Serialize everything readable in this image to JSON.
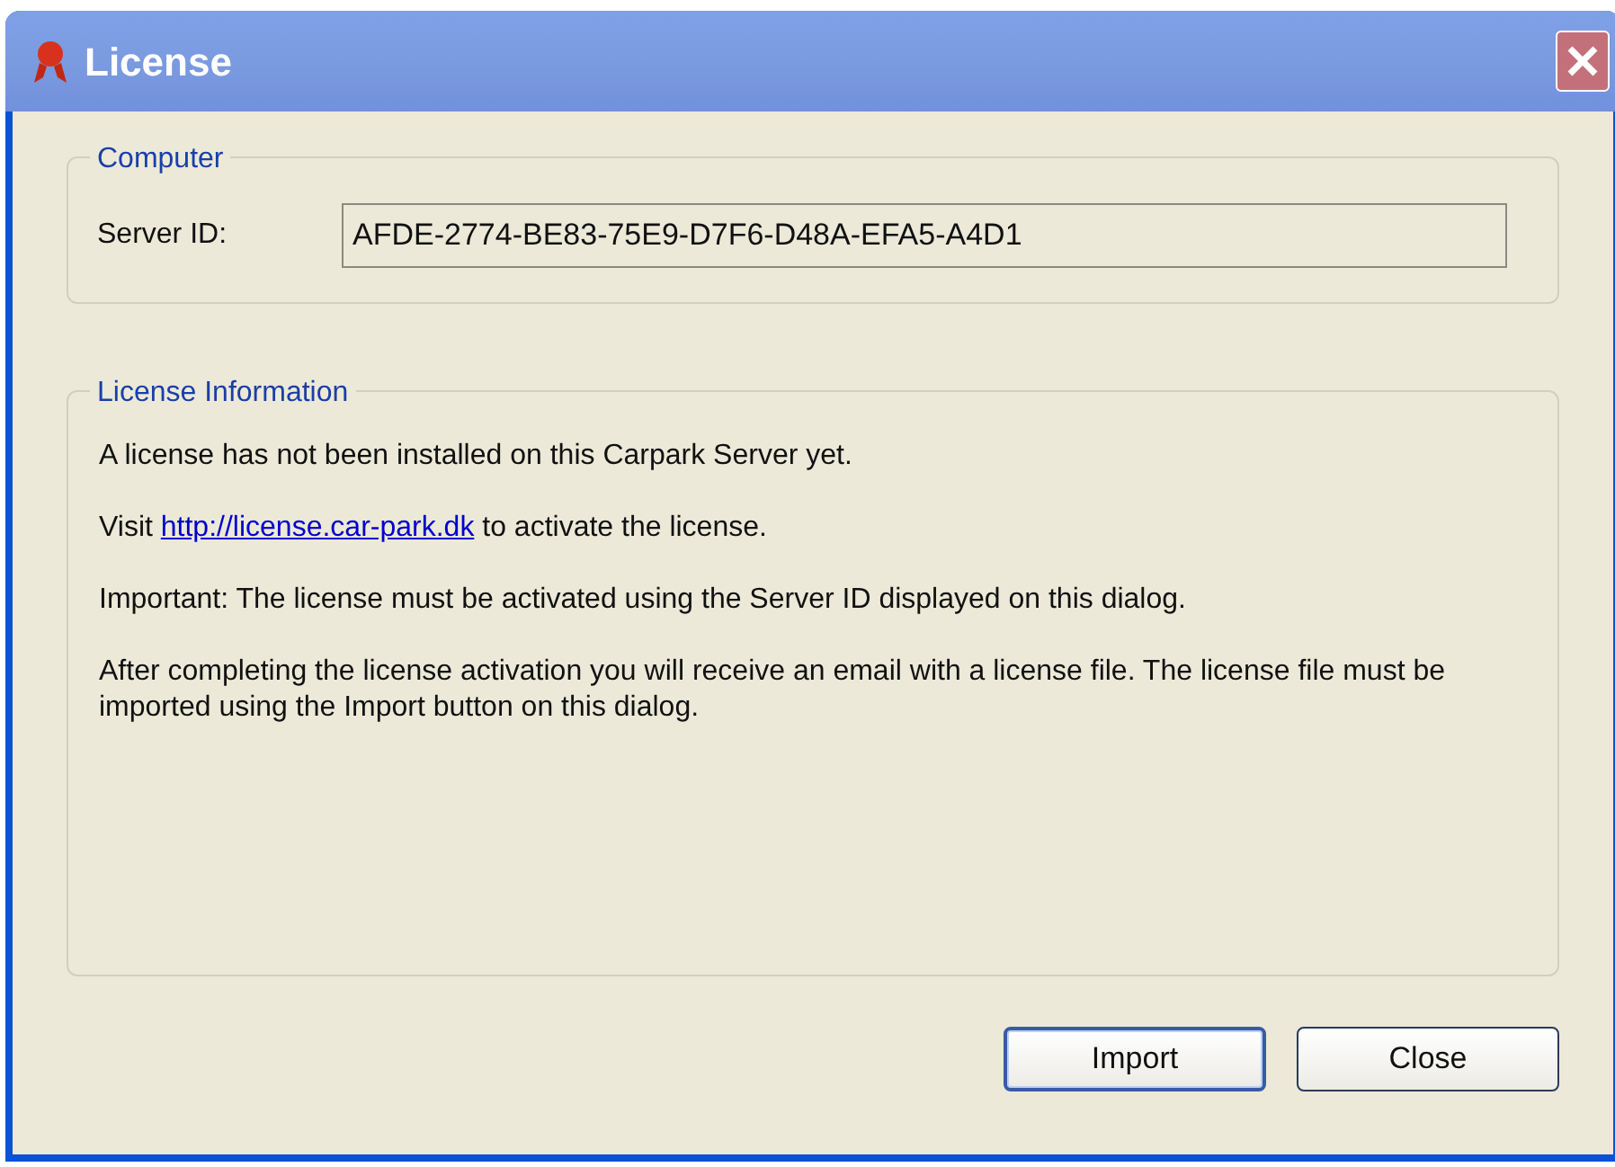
{
  "window": {
    "title": "License"
  },
  "computer_group": {
    "legend": "Computer",
    "label": "Server ID:",
    "value": "AFDE-2774-BE83-75E9-D7F6-D48A-EFA5-A4D1"
  },
  "license_group": {
    "legend": "License Information",
    "paragraphs": [
      {
        "kind": "text",
        "text": "A license has not been installed on this Carpark Server yet."
      },
      {
        "kind": "link",
        "before": "Visit ",
        "link": "http://license.car-park.dk",
        "after": " to activate the license."
      },
      {
        "kind": "text",
        "text": "Important: The license must be activated using the Server ID displayed on this dialog."
      },
      {
        "kind": "text",
        "text": "After completing the license activation you will receive an email with a license file. The license file must be imported using the Import button on this dialog."
      }
    ]
  },
  "buttons": [
    {
      "label": "Import",
      "selected": true
    },
    {
      "label": "Close",
      "selected": false
    }
  ]
}
